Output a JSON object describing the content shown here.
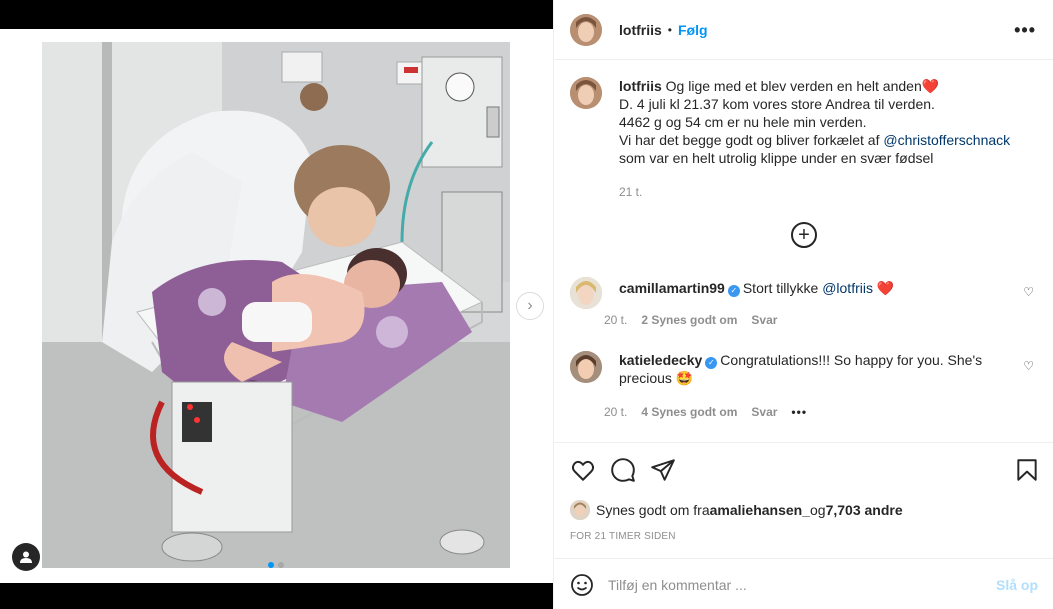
{
  "header": {
    "username": "lotfriis",
    "separator": "•",
    "follow_label": "Følg",
    "more_label": "•••"
  },
  "caption": {
    "username": "lotfriis",
    "line1": "Og lige med et blev verden en helt anden",
    "line1_emoji": "❤️",
    "line2": "D. 4 juli kl 21.37 kom vores store Andrea til verden.",
    "line3": "4462 g og 54 cm er nu hele min verden.",
    "line4_prefix": "Vi har det begge godt og bliver forkælet af ",
    "mention": "@christofferschnack",
    "line5": "som var en helt utrolig klippe under en svær fødsel",
    "time": "21 t."
  },
  "load_more_label": "+",
  "comments": [
    {
      "username": "camillamartin99",
      "text_prefix": "Stort tillykke ",
      "mention": "@lotfriis",
      "emoji": "❤️",
      "time": "20 t.",
      "likes": "2 Synes godt om",
      "reply": "Svar"
    },
    {
      "username": "katieledecky",
      "text": "Congratulations!!! So happy for you. She's precious",
      "emoji": "🤩",
      "time": "20 t.",
      "likes": "4 Synes godt om",
      "reply": "Svar",
      "more": "•••"
    }
  ],
  "likes": {
    "prefix": "Synes godt om fra ",
    "user": "amaliehansen_",
    "middle": " og ",
    "count": "7,703 andre"
  },
  "timestamp": "FOR 21 TIMER SIDEN",
  "comment_input": {
    "placeholder": "Tilføj en kommentar ...",
    "post_label": "Slå op"
  },
  "media": {
    "next_label": "›",
    "slide_count": 2,
    "active_slide": 1
  },
  "colors": {
    "accent": "#0095f6",
    "link": "#00376b",
    "muted": "#8e8e8e",
    "verified": "#3897f0",
    "post_disabled": "#b2dffc"
  }
}
